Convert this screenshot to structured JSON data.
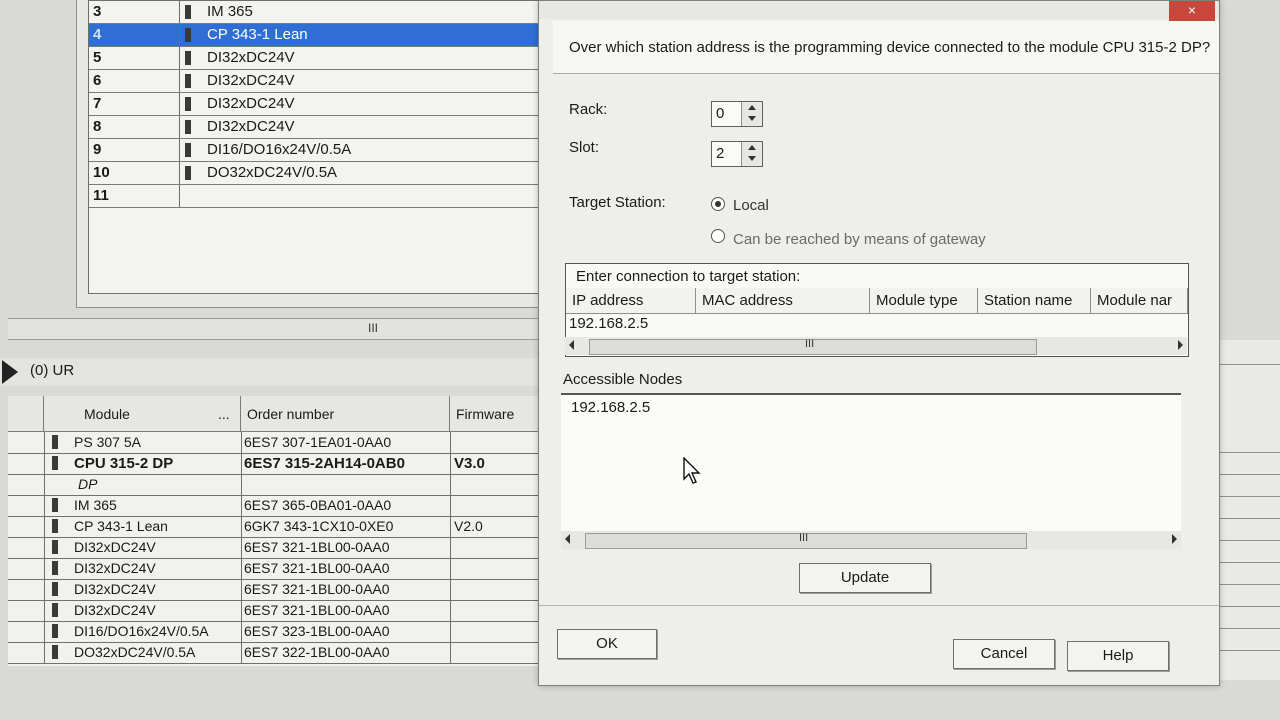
{
  "rack": {
    "rows": [
      {
        "slot": "3",
        "module": "IM 365"
      },
      {
        "slot": "4",
        "module": "CP 343-1 Lean",
        "selected": true
      },
      {
        "slot": "5",
        "module": "DI32xDC24V"
      },
      {
        "slot": "6",
        "module": "DI32xDC24V"
      },
      {
        "slot": "7",
        "module": "DI32xDC24V"
      },
      {
        "slot": "8",
        "module": "DI32xDC24V"
      },
      {
        "slot": "9",
        "module": "DI16/DO16x24V/0.5A"
      },
      {
        "slot": "10",
        "module": "DO32xDC24V/0.5A"
      },
      {
        "slot": "11",
        "module": ""
      }
    ],
    "scroll_grip": "III"
  },
  "station": {
    "label": "(0)  UR"
  },
  "detail_table": {
    "headers": {
      "module": "Module",
      "ellipsis": "...",
      "order": "Order number",
      "firmware": "Firmware"
    },
    "rows": [
      {
        "module": "PS 307 5A",
        "order": "6ES7 307-1EA01-0AA0",
        "firmware": ""
      },
      {
        "module": "CPU 315-2 DP",
        "order": "6ES7 315-2AH14-0AB0",
        "firmware": "V3.0",
        "bold": true
      },
      {
        "module": "DP",
        "order": "",
        "firmware": "",
        "italic": true
      },
      {
        "module": "IM 365",
        "order": "6ES7 365-0BA01-0AA0",
        "firmware": ""
      },
      {
        "module": "CP 343-1 Lean",
        "order": "6GK7 343-1CX10-0XE0",
        "firmware": "V2.0"
      },
      {
        "module": "DI32xDC24V",
        "order": "6ES7 321-1BL00-0AA0",
        "firmware": ""
      },
      {
        "module": "DI32xDC24V",
        "order": "6ES7 321-1BL00-0AA0",
        "firmware": ""
      },
      {
        "module": "DI32xDC24V",
        "order": "6ES7 321-1BL00-0AA0",
        "firmware": ""
      },
      {
        "module": "DI32xDC24V",
        "order": "6ES7 321-1BL00-0AA0",
        "firmware": ""
      },
      {
        "module": "DI16/DO16x24V/0.5A",
        "order": "6ES7 323-1BL00-0AA0",
        "firmware": ""
      },
      {
        "module": "DO32xDC24V/0.5A",
        "order": "6ES7 322-1BL00-0AA0",
        "firmware": ""
      }
    ]
  },
  "dialog": {
    "close_label": "×",
    "question": "Over which station address is the programming device connected to the module CPU 315-2 DP?",
    "rack_label": "Rack:",
    "rack_value": "0",
    "slot_label": "Slot:",
    "slot_value": "2",
    "target_station_label": "Target Station:",
    "target_local": "Local",
    "target_gateway": "Can be reached by means of gateway",
    "connection": {
      "title": "Enter connection to target station:",
      "columns": [
        "IP address",
        "MAC address",
        "Module type",
        "Station name",
        "Module nar"
      ],
      "ip_value": "192.168.2.5",
      "scroll_grip": "III"
    },
    "accessible_nodes": {
      "label": "Accessible Nodes",
      "items": [
        "192.168.2.5"
      ],
      "scroll_grip": "III"
    },
    "buttons": {
      "update": "Update",
      "ok": "OK",
      "cancel": "Cancel",
      "help": "Help"
    }
  }
}
